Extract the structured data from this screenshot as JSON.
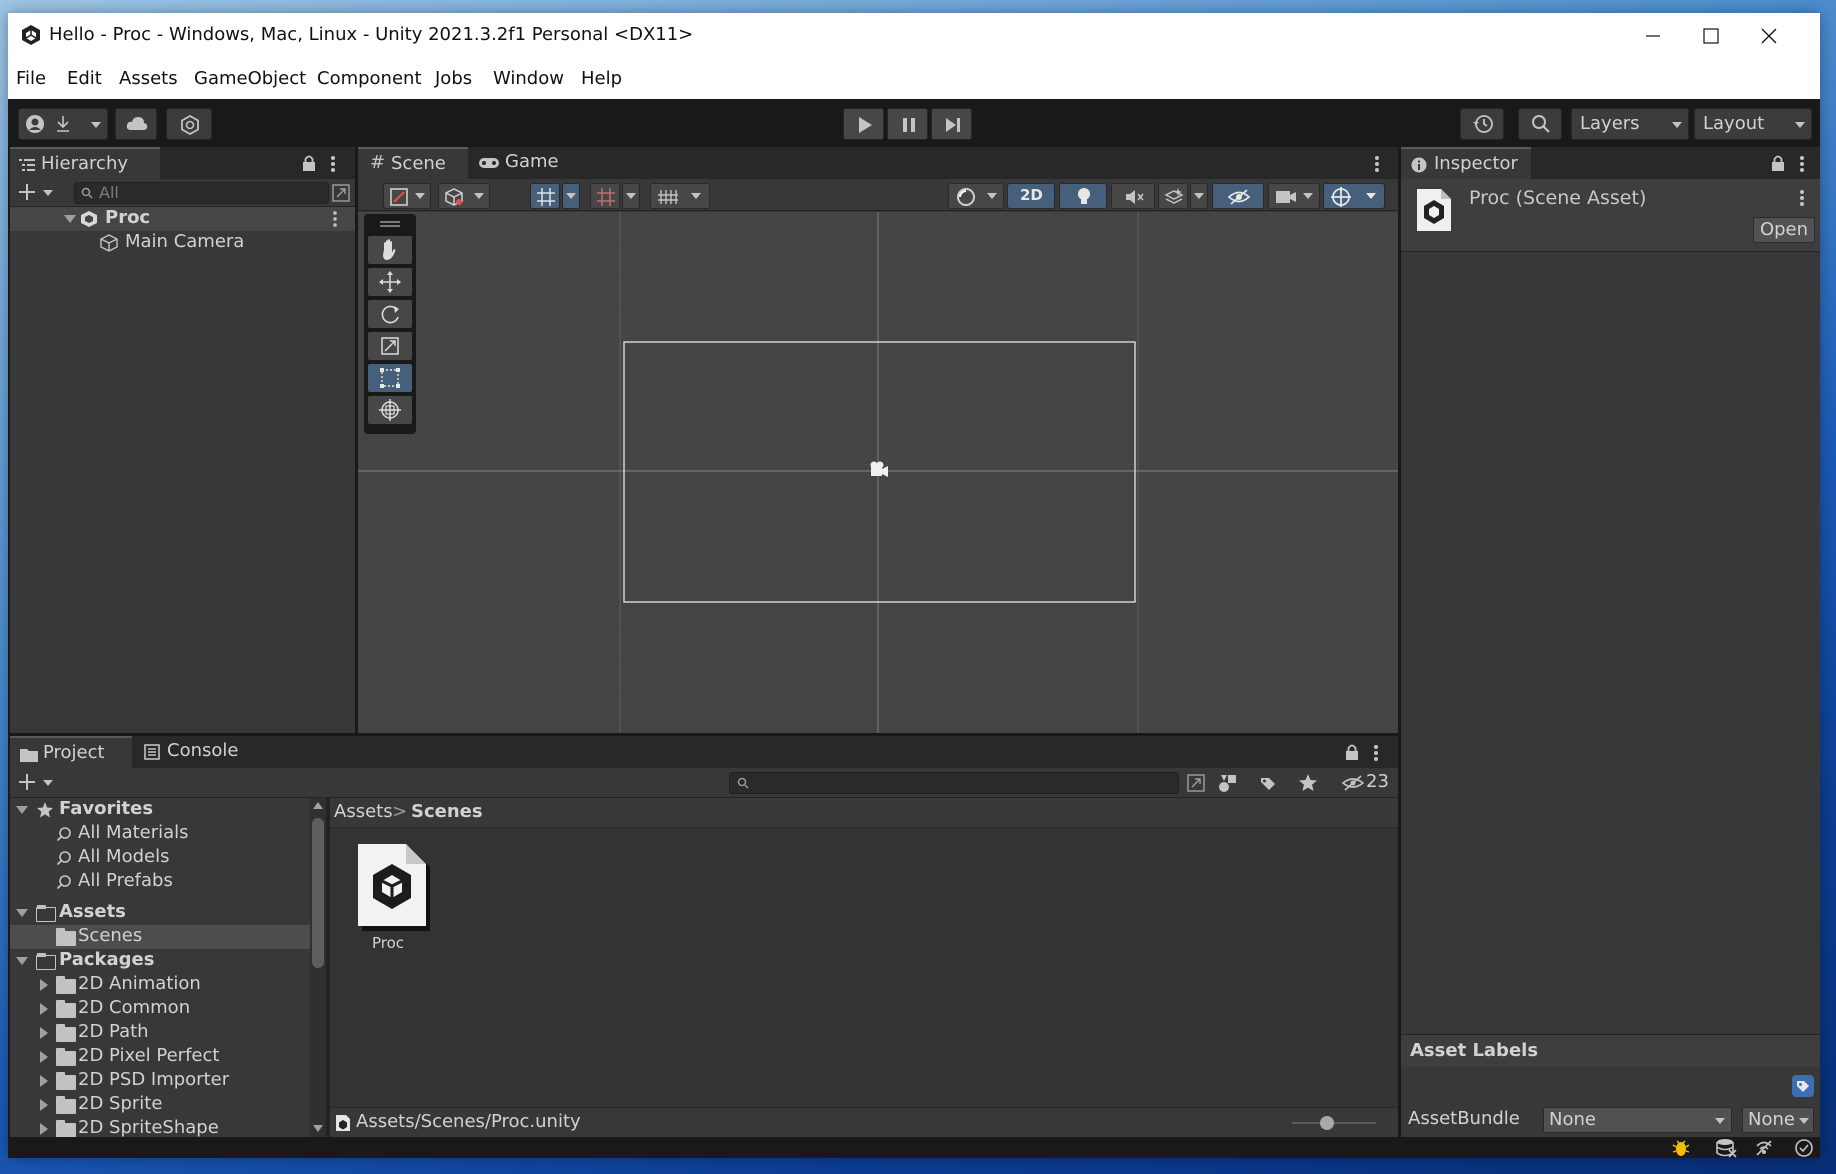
{
  "window": {
    "title": "Hello - Proc - Windows, Mac, Linux - Unity 2021.3.2f1 Personal <DX11>",
    "controls": {
      "minimize": "minimize-icon",
      "maximize": "maximize-icon",
      "close": "close-icon"
    }
  },
  "menu": [
    "File",
    "Edit",
    "Assets",
    "GameObject",
    "Component",
    "Jobs",
    "Window",
    "Help"
  ],
  "toolbar": {
    "account_icon": "account-icon",
    "collab_icon": "cloud-icon",
    "services_icon": "services-icon",
    "play_icon": "play-icon",
    "pause_icon": "pause-icon",
    "step_icon": "step-icon",
    "history_icon": "history-icon",
    "search_icon": "search-icon",
    "layers_label": "Layers",
    "layout_label": "Layout"
  },
  "hierarchy": {
    "tab": "Hierarchy",
    "search_placeholder": "All",
    "scene_name": "Proc",
    "items": [
      "Main Camera"
    ]
  },
  "scene_view": {
    "tabs": [
      "Scene",
      "Game"
    ],
    "mode_2d_label": "2D",
    "tools": [
      "hand-tool-icon",
      "move-tool-icon",
      "rotate-tool-icon",
      "scale-tool-icon",
      "rect-tool-icon",
      "transform-tool-icon"
    ],
    "active_tool": "rect-tool-icon"
  },
  "inspector": {
    "tab": "Inspector",
    "asset_title": "Proc (Scene Asset)",
    "open_button": "Open",
    "asset_labels_heading": "Asset Labels",
    "assetbundle_label": "AssetBundle",
    "assetbundle_value": "None",
    "assetbundle_variant": "None"
  },
  "project": {
    "tabs": [
      "Project",
      "Console"
    ],
    "hidden_count": "23",
    "favorites_label": "Favorites",
    "favorites": [
      "All Materials",
      "All Models",
      "All Prefabs"
    ],
    "assets_label": "Assets",
    "assets_children": [
      "Scenes"
    ],
    "packages_label": "Packages",
    "packages": [
      "2D Animation",
      "2D Common",
      "2D Path",
      "2D Pixel Perfect",
      "2D PSD Importer",
      "2D Sprite",
      "2D SpriteShape"
    ],
    "breadcrumb": [
      "Assets",
      "Scenes"
    ],
    "breadcrumb_separator": ">",
    "grid_items": [
      {
        "name": "Proc",
        "icon": "unity-scene-icon"
      }
    ],
    "status_path": "Assets/Scenes/Proc.unity",
    "zoom_slider": 0.4
  },
  "statusbar": {
    "icons": [
      "debug-icon",
      "cache-server-icon",
      "network-icon",
      "progress-icon"
    ]
  },
  "colors": {
    "editor_bg": "#383838",
    "tab_bar": "#282828",
    "scene_bg": "#444444",
    "selection": "#4d4d4d",
    "active_button": "#46607c"
  }
}
